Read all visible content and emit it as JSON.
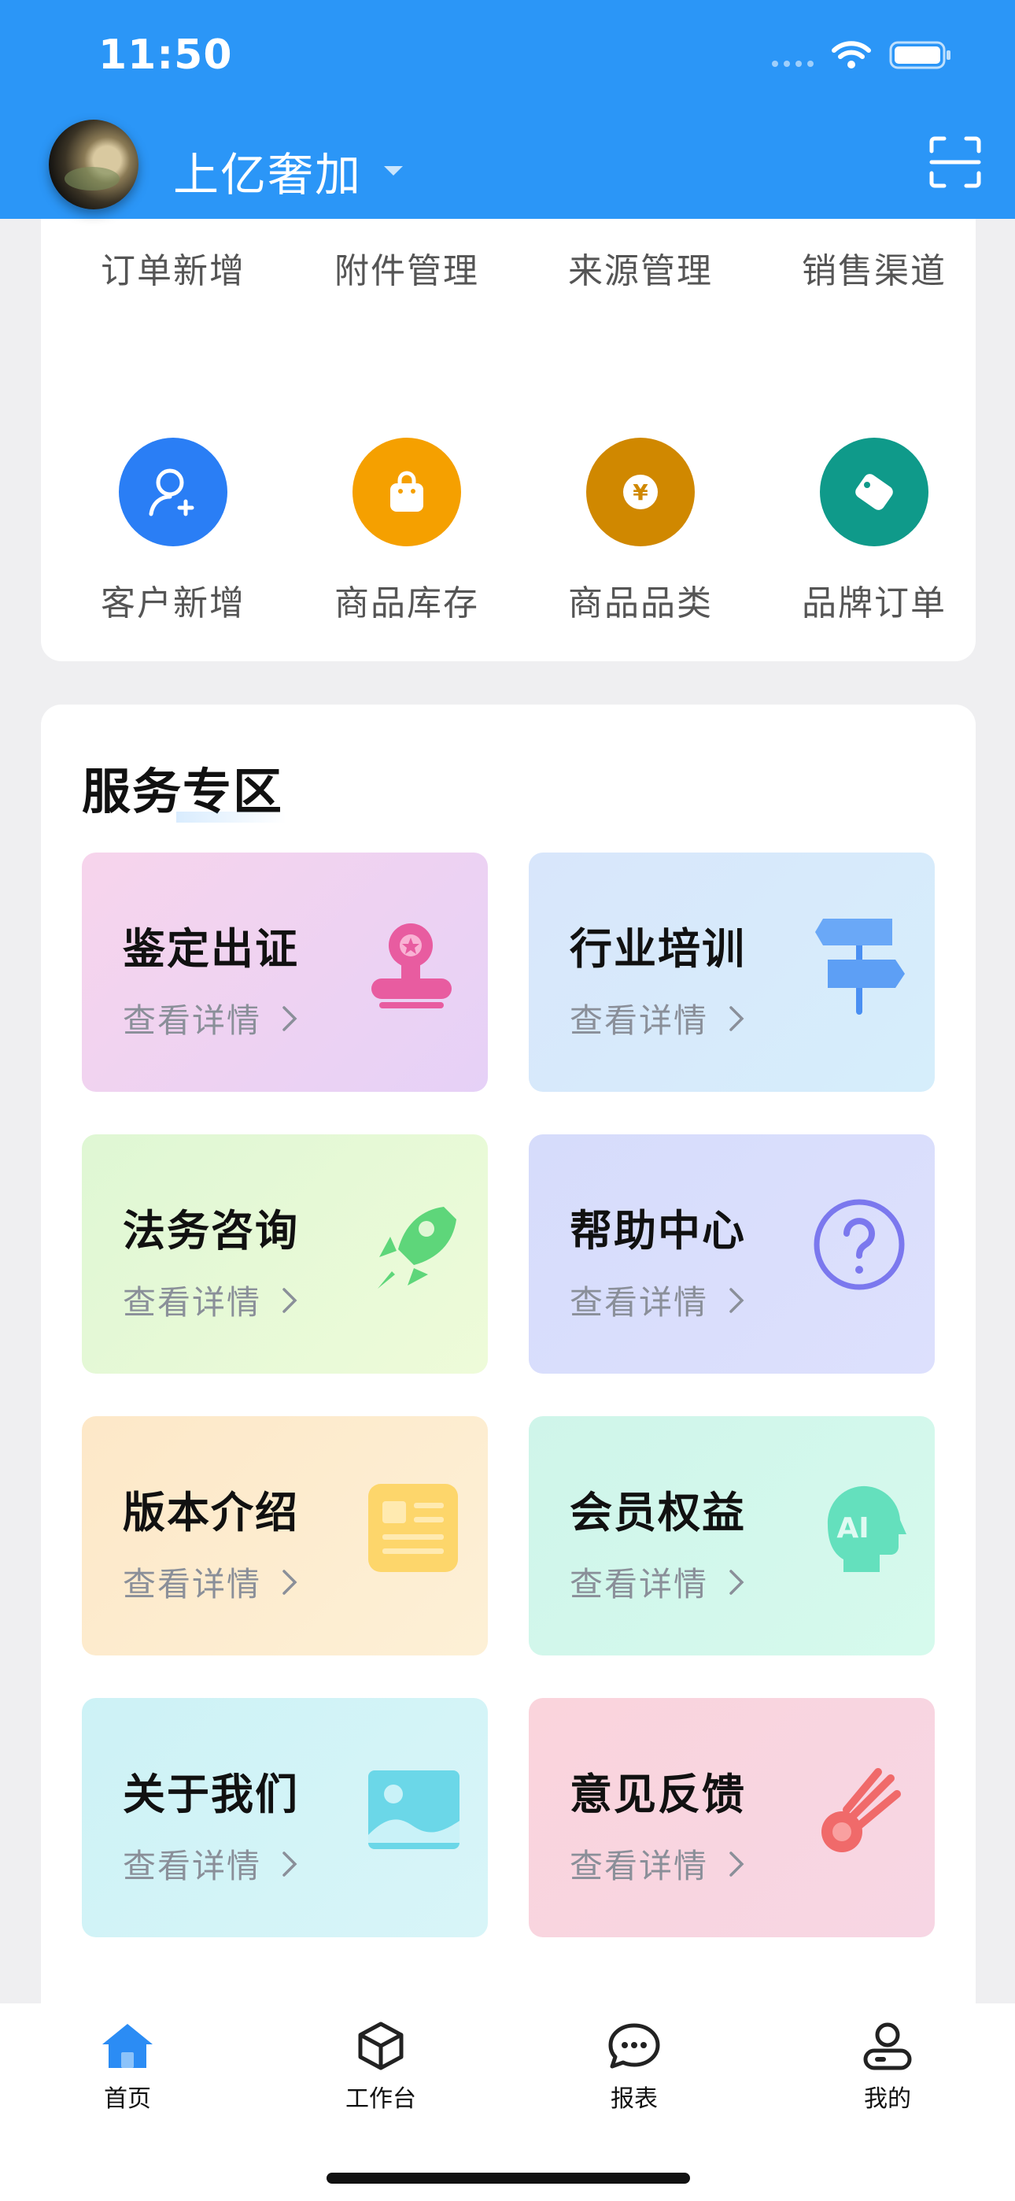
{
  "status": {
    "time": "11:50"
  },
  "header": {
    "title": "上亿奢加",
    "avatar_icon": "avatar-image",
    "scan_icon": "scan-icon"
  },
  "quick_grid": [
    {
      "label": "订单新增",
      "icon": "plus-icon",
      "color": "#2a7ef5"
    },
    {
      "label": "附件管理",
      "icon": "tag-icon",
      "color": "#2b96f7"
    },
    {
      "label": "来源管理",
      "icon": "link-icon",
      "color": "#ffb44a"
    },
    {
      "label": "销售渠道",
      "icon": "planet-icon",
      "color": "#2b96f7"
    },
    {
      "label": "客户新增",
      "icon": "user-add-icon",
      "color": "#2a7ef5"
    },
    {
      "label": "商品库存",
      "icon": "bag-icon",
      "color": "#f5a000"
    },
    {
      "label": "商品品类",
      "icon": "yen-icon",
      "color": "#d08800"
    },
    {
      "label": "品牌订单",
      "icon": "tag-icon",
      "color": "#0f9a8a"
    }
  ],
  "services": {
    "title": "服务专区",
    "more_label": "查看详情",
    "tiles": [
      {
        "name": "鉴定出证",
        "icon": "stamp-icon"
      },
      {
        "name": "行业培训",
        "icon": "signpost-icon"
      },
      {
        "name": "法务咨询",
        "icon": "rocket-icon"
      },
      {
        "name": "帮助中心",
        "icon": "question-icon"
      },
      {
        "name": "版本介绍",
        "icon": "news-icon"
      },
      {
        "name": "会员权益",
        "icon": "ai-head-icon"
      },
      {
        "name": "关于我们",
        "icon": "picture-icon"
      },
      {
        "name": "意见反馈",
        "icon": "comet-icon"
      }
    ]
  },
  "nav": [
    {
      "label": "首页",
      "icon": "home-icon",
      "active": true
    },
    {
      "label": "工作台",
      "icon": "cube-icon",
      "active": false
    },
    {
      "label": "报表",
      "icon": "chat-icon",
      "active": false
    },
    {
      "label": "我的",
      "icon": "profile-icon",
      "active": false
    }
  ]
}
